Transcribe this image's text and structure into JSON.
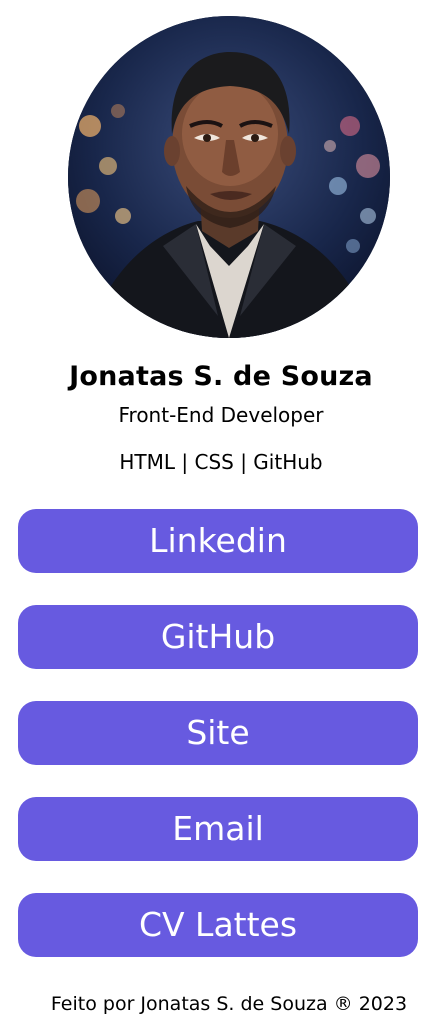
{
  "profile": {
    "photo_alt": "profile-photo",
    "name": "Jonatas S. de Souza",
    "role": "Front-End Developer",
    "skills": "HTML | CSS | GitHub"
  },
  "links": [
    {
      "label": "Linkedin"
    },
    {
      "label": "GitHub"
    },
    {
      "label": "Site"
    },
    {
      "label": "Email"
    },
    {
      "label": "CV Lattes"
    }
  ],
  "footer": {
    "text": "Feito por Jonatas S. de Souza ® 2023"
  },
  "colors": {
    "button_bg": "#675ae0",
    "button_text": "#ffffff",
    "page_bg": "#ffffff"
  }
}
